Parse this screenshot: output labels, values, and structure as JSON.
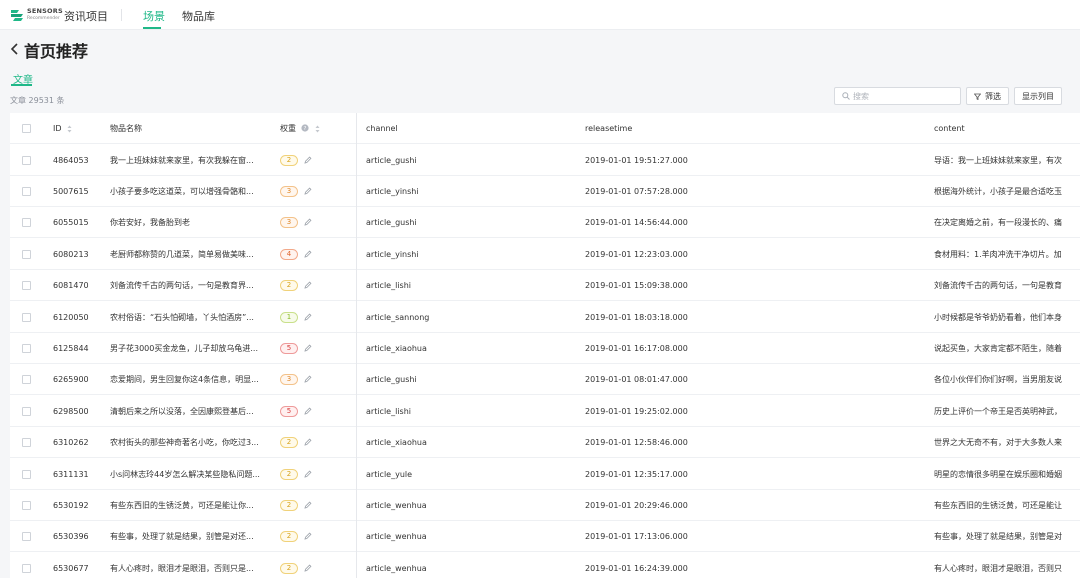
{
  "brand": {
    "line1": "SENSORS",
    "line2": "Recommender"
  },
  "topbar": {
    "project": "资讯项目",
    "nav": [
      "场景",
      "物品库"
    ],
    "active_nav": 0
  },
  "page": {
    "title": "首页推荐",
    "tab": "文章",
    "count": "文章 29531 条"
  },
  "toolbar": {
    "search_placeholder": "搜索",
    "filter_label": "筛选",
    "columns_label": "显示列目"
  },
  "colors": {
    "accent": "#1fb888"
  },
  "columns": {
    "id": "ID",
    "name": "物品名称",
    "weight": "权重",
    "channel": "channel",
    "releasetime": "releasetime",
    "content": "content"
  },
  "rows": [
    {
      "id": "4864053",
      "name": "我一上班妹妹就来家里，有次我躲在窗...",
      "weight": "2",
      "channel": "article_gushi",
      "releasetime": "2019-01-01 19:51:27.000",
      "content": "导语：我一上班妹妹就来家里，有次"
    },
    {
      "id": "5007615",
      "name": "小孩子要多吃这道菜，可以增强骨骼和...",
      "weight": "3",
      "channel": "article_yinshi",
      "releasetime": "2019-01-01 07:57:28.000",
      "content": "根据海外统计，小孩子是最合适吃玉"
    },
    {
      "id": "6055015",
      "name": "你若安好，我备胎到老",
      "weight": "3",
      "channel": "article_gushi",
      "releasetime": "2019-01-01 14:56:44.000",
      "content": "在决定离婚之前，有一段漫长的、痛"
    },
    {
      "id": "6080213",
      "name": "老厨师都称赞的几道菜，简单易做美味...",
      "weight": "4",
      "channel": "article_yinshi",
      "releasetime": "2019-01-01 12:23:03.000",
      "content": "食材用料：1.羊肉冲洗干净切片。加"
    },
    {
      "id": "6081470",
      "name": "刘备流传千古的两句话，一句是教育界...",
      "weight": "2",
      "channel": "article_lishi",
      "releasetime": "2019-01-01 15:09:38.000",
      "content": "刘备流传千古的两句话，一句是教育"
    },
    {
      "id": "6120050",
      "name": "农村俗语：“石头怕砌墙，丫头怕酒房”...",
      "weight": "1",
      "channel": "article_sannong",
      "releasetime": "2019-01-01 18:03:18.000",
      "content": "小时候都是爷爷奶奶看着，他们本身"
    },
    {
      "id": "6125844",
      "name": "男子花3000买金龙鱼，儿子却放乌龟进...",
      "weight": "5",
      "channel": "article_xiaohua",
      "releasetime": "2019-01-01 16:17:08.000",
      "content": "说起买鱼，大家肯定都不陌生，随着"
    },
    {
      "id": "6265900",
      "name": "恋爱期间，男生回复你这4条信息，明显...",
      "weight": "3",
      "channel": "article_gushi",
      "releasetime": "2019-01-01 08:01:47.000",
      "content": "各位小伙伴们你们好啊，当男朋友说"
    },
    {
      "id": "6298500",
      "name": "清朝后来之所以没落，全因康熙登基后...",
      "weight": "5",
      "channel": "article_lishi",
      "releasetime": "2019-01-01 19:25:02.000",
      "content": "历史上评价一个帝王是否英明神武，"
    },
    {
      "id": "6310262",
      "name": "农村街头的那些神奇著名小吃，你吃过3...",
      "weight": "2",
      "channel": "article_xiaohua",
      "releasetime": "2019-01-01 12:58:46.000",
      "content": "世界之大无奇不有，对于大多数人来"
    },
    {
      "id": "6311131",
      "name": "小s问林志玲44岁怎么解决某些隐私问题...",
      "weight": "2",
      "channel": "article_yule",
      "releasetime": "2019-01-01 12:35:17.000",
      "content": "明星的恋情很多明星在娱乐圈和婚姻"
    },
    {
      "id": "6530192",
      "name": "有些东西旧的生锈泛黄，可还是能让你...",
      "weight": "2",
      "channel": "article_wenhua",
      "releasetime": "2019-01-01 20:29:46.000",
      "content": "有些东西旧的生锈泛黄，可还是能让"
    },
    {
      "id": "6530396",
      "name": "有些事，处理了就是结果，别管是对还...",
      "weight": "2",
      "channel": "article_wenhua",
      "releasetime": "2019-01-01 17:13:06.000",
      "content": "有些事，处理了就是结果，别管是对"
    },
    {
      "id": "6530677",
      "name": "有人心疼时，眼泪才是眼泪，否则只是...",
      "weight": "2",
      "channel": "article_wenhua",
      "releasetime": "2019-01-01 16:24:39.000",
      "content": "有人心疼时，眼泪才是眼泪，否则只"
    }
  ]
}
